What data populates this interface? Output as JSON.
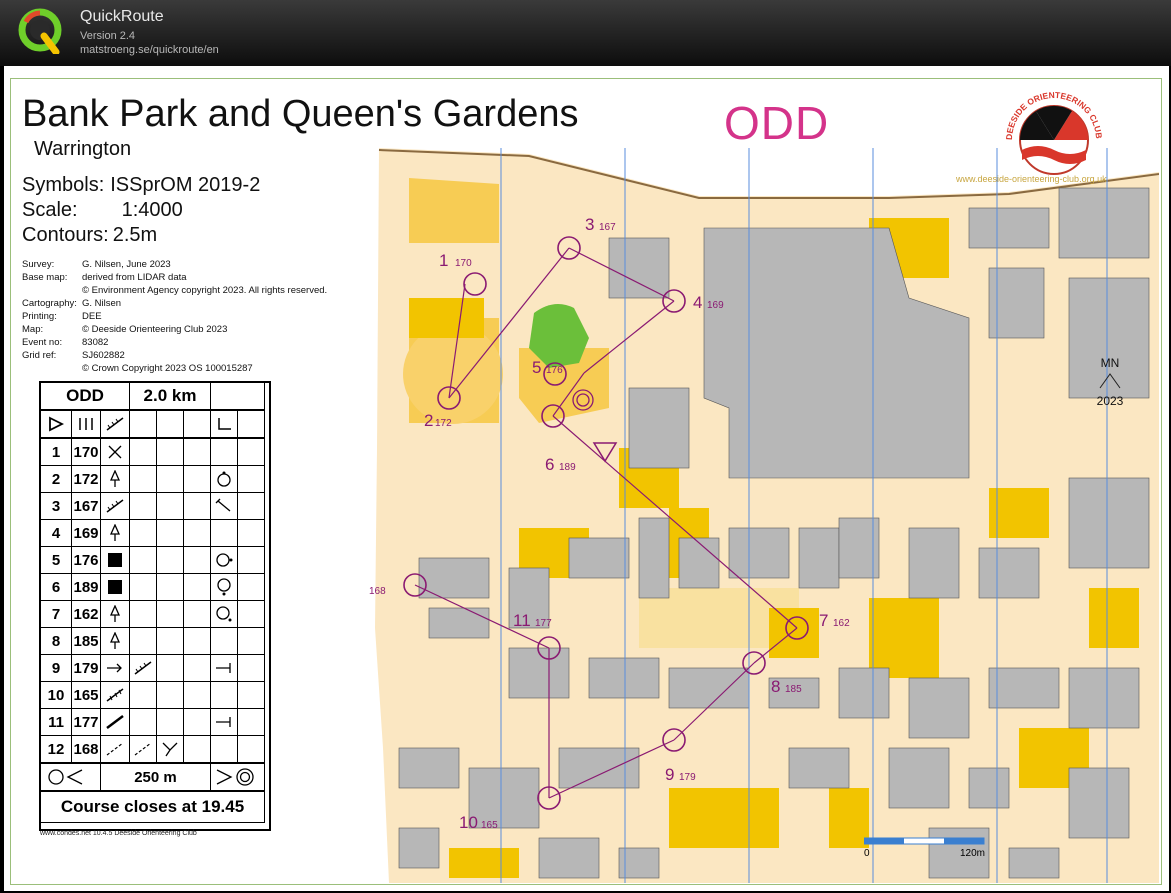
{
  "app": {
    "name": "QuickRoute",
    "version": "Version 2.4",
    "url": "matstroeng.se/quickroute/en"
  },
  "map": {
    "title": "Bank Park and Queen's Gardens",
    "subtitle": "Warrington",
    "course_badge": "ODD",
    "specs": {
      "symbols_label": "Symbols:",
      "symbols_value": "ISSprOM 2019-2",
      "scale_label": "Scale:",
      "scale_value": "1:4000",
      "contours_label": "Contours:",
      "contours_value": "2.5m"
    },
    "credits": [
      {
        "k": "Survey:",
        "v": "G. Nilsen, June 2023"
      },
      {
        "k": "Base map:",
        "v": "derived from LIDAR data"
      },
      {
        "k": "",
        "v": "© Environment Agency copyright 2023. All rights reserved."
      },
      {
        "k": "Cartography:",
        "v": "G. Nilsen"
      },
      {
        "k": "Printing:",
        "v": "DEE"
      },
      {
        "k": "Map:",
        "v": "© Deeside Orienteering Club 2023"
      },
      {
        "k": "Event no:",
        "v": "83082"
      },
      {
        "k": "Grid ref:",
        "v": "SJ602882"
      },
      {
        "k": "",
        "v": "© Crown Copyright 2023 OS 100015287"
      }
    ],
    "club_url": "www.deeside-orienteering-club.org.uk",
    "club_name": "DEESIDE ORIENTEERING CLUB",
    "north": {
      "label": "MN",
      "year": "2023"
    },
    "scalebar": {
      "start": "0",
      "end": "120m"
    },
    "footnote": "www.condes.net 10.4.5 Deeside Orienteering Club",
    "colors": {
      "course": "#8a1a72",
      "badge": "#d4338a",
      "building": "#b5b5b5",
      "open": "#f5d97a",
      "rough": "#f2c200"
    }
  },
  "description": {
    "course": "ODD",
    "length": "2.0 km",
    "rows": [
      {
        "n": "1",
        "code": "170"
      },
      {
        "n": "2",
        "code": "172"
      },
      {
        "n": "3",
        "code": "167"
      },
      {
        "n": "4",
        "code": "169"
      },
      {
        "n": "5",
        "code": "176"
      },
      {
        "n": "6",
        "code": "189"
      },
      {
        "n": "7",
        "code": "162"
      },
      {
        "n": "8",
        "code": "185"
      },
      {
        "n": "9",
        "code": "179"
      },
      {
        "n": "10",
        "code": "165"
      },
      {
        "n": "11",
        "code": "177"
      },
      {
        "n": "12",
        "code": "168"
      }
    ],
    "finish_distance": "250 m",
    "close": "Course closes at 19.45"
  },
  "controls": [
    {
      "n": "1",
      "code": "170"
    },
    {
      "n": "2",
      "code": "172"
    },
    {
      "n": "3",
      "code": "167"
    },
    {
      "n": "4",
      "code": "169"
    },
    {
      "n": "5",
      "code": "176"
    },
    {
      "n": "6",
      "code": "189"
    },
    {
      "n": "7",
      "code": "162"
    },
    {
      "n": "8",
      "code": "185"
    },
    {
      "n": "9",
      "code": "179"
    },
    {
      "n": "10",
      "code": "165"
    },
    {
      "n": "11",
      "code": "177"
    },
    {
      "n": "12",
      "code": "168"
    }
  ]
}
